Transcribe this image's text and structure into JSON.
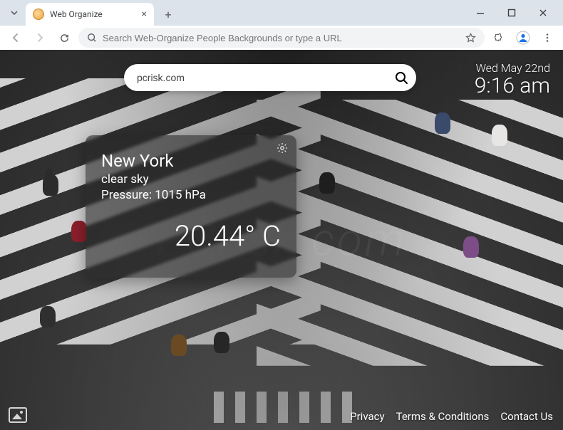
{
  "browser": {
    "tab_title": "Web Organize",
    "omnibox_placeholder": "Search Web-Organize People Backgrounds or type a URL"
  },
  "search": {
    "value": "pcrisk.com"
  },
  "datetime": {
    "date": "Wed May 22nd",
    "time": "9:16 am"
  },
  "weather": {
    "city": "New York",
    "condition": "clear sky",
    "pressure_label": "Pressure: 1015 hPa",
    "temperature": "20.44° C"
  },
  "footer": {
    "privacy": "Privacy",
    "terms": "Terms & Conditions",
    "contact": "Contact Us"
  },
  "watermark": "PCrisk.com"
}
